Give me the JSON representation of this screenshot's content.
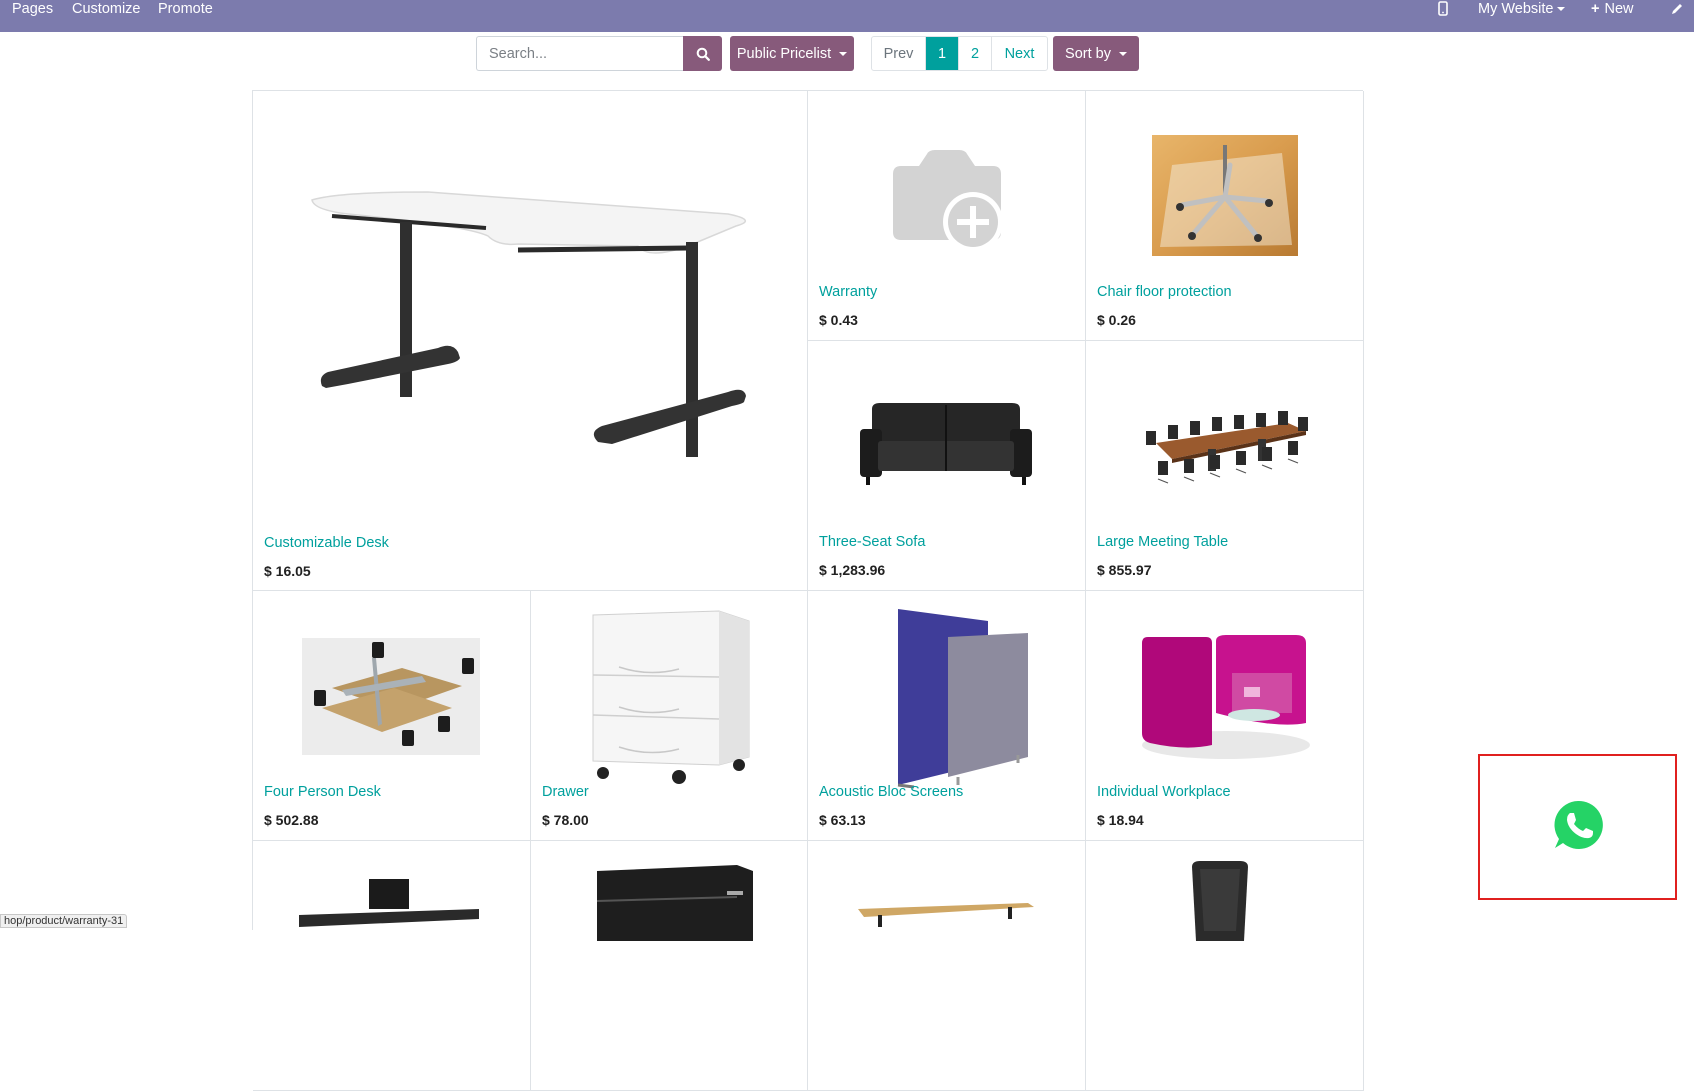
{
  "topbar": {
    "left_items": [
      "Pages",
      "Customize",
      "Promote"
    ],
    "website_label": "My Website",
    "new_label": "New"
  },
  "search": {
    "placeholder": "Search..."
  },
  "pricelist": {
    "label": "Public Pricelist"
  },
  "pager": {
    "prev": "Prev",
    "pages": [
      "1",
      "2"
    ],
    "active_page": "1",
    "next": "Next"
  },
  "sort": {
    "label": "Sort by"
  },
  "products": [
    {
      "name": "Customizable Desk",
      "price": "$ 16.05",
      "image": "desk-image"
    },
    {
      "name": "Warranty",
      "price": "$ 0.43",
      "image": "camera-placeholder-image"
    },
    {
      "name": "Chair floor protection",
      "price": "$ 0.26",
      "image": "chair-floor-image"
    },
    {
      "name": "Three-Seat Sofa",
      "price": "$ 1,283.96",
      "image": "sofa-image"
    },
    {
      "name": "Large Meeting Table",
      "price": "$ 855.97",
      "image": "meeting-table-image"
    },
    {
      "name": "Four Person Desk",
      "price": "$ 502.88",
      "image": "four-person-desk-image"
    },
    {
      "name": "Drawer",
      "price": "$ 78.00",
      "image": "drawer-image"
    },
    {
      "name": "Acoustic Bloc Screens",
      "price": "$ 63.13",
      "image": "acoustic-screens-image"
    },
    {
      "name": "Individual Workplace",
      "price": "$ 18.94",
      "image": "workplace-pod-image"
    }
  ],
  "status_bar": {
    "url": "hop/product/warranty-31"
  },
  "colors": {
    "topbar": "#7c7bad",
    "primary": "#875a7b",
    "link": "#00a09d",
    "whatsapp": "#25d366",
    "highlight": "#e0201f"
  }
}
